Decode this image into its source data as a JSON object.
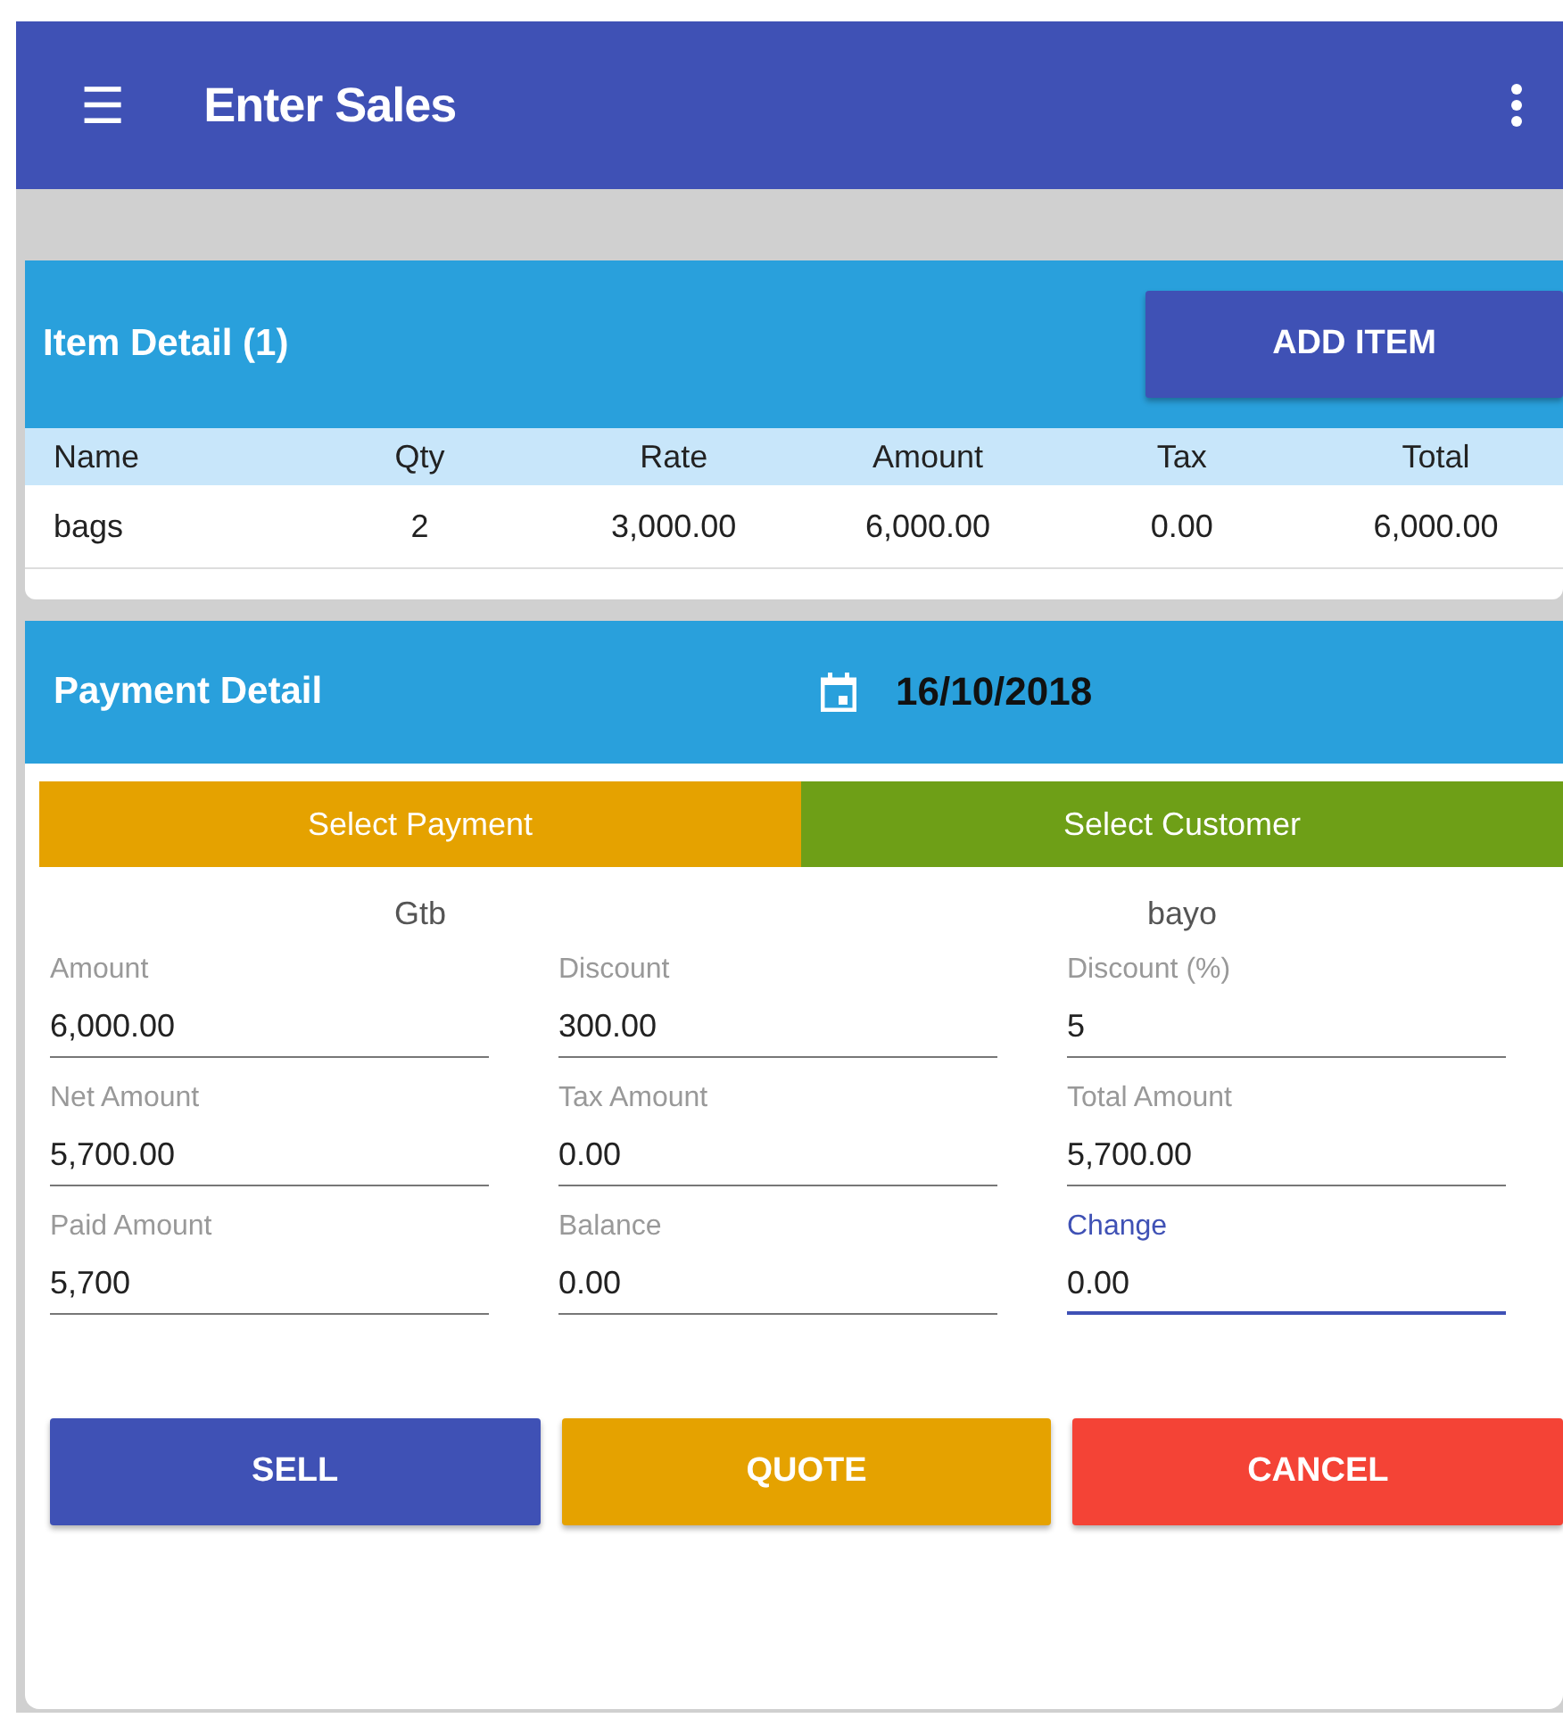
{
  "app_bar": {
    "menu_icon": "☰",
    "title": "Enter Sales"
  },
  "item_detail": {
    "title": "Item Detail (1)",
    "add_button": "ADD ITEM",
    "columns": [
      "Name",
      "Qty",
      "Rate",
      "Amount",
      "Tax",
      "Total"
    ],
    "rows": [
      [
        "bags",
        "2",
        "3,000.00",
        "6,000.00",
        "0.00",
        "6,000.00"
      ]
    ]
  },
  "payment_detail": {
    "title": "Payment Detail",
    "date": "16/10/2018",
    "selectors": [
      {
        "label": "Select Payment",
        "color": "#e5a200",
        "value": "Gtb"
      },
      {
        "label": "Select Customer",
        "color": "#6e9f17",
        "value": "bayo"
      }
    ],
    "fields": [
      {
        "label": "Amount",
        "value": "6,000.00",
        "focused": false
      },
      {
        "label": "Discount",
        "value": "300.00",
        "focused": false
      },
      {
        "label": "Discount (%)",
        "value": "5",
        "focused": false
      },
      {
        "label": "Net Amount",
        "value": "5,700.00",
        "focused": false
      },
      {
        "label": "Tax Amount",
        "value": "0.00",
        "focused": false
      },
      {
        "label": "Total Amount",
        "value": "5,700.00",
        "focused": false
      },
      {
        "label": "Paid Amount",
        "value": "5,700",
        "focused": false
      },
      {
        "label": "Balance",
        "value": "0.00",
        "focused": false
      },
      {
        "label": "Change",
        "value": "0.00",
        "focused": true
      }
    ],
    "buttons": [
      {
        "label": "SELL",
        "color": "#3f51b5"
      },
      {
        "label": "QUOTE",
        "color": "#e5a200"
      },
      {
        "label": "CANCEL",
        "color": "#f44336"
      }
    ]
  }
}
